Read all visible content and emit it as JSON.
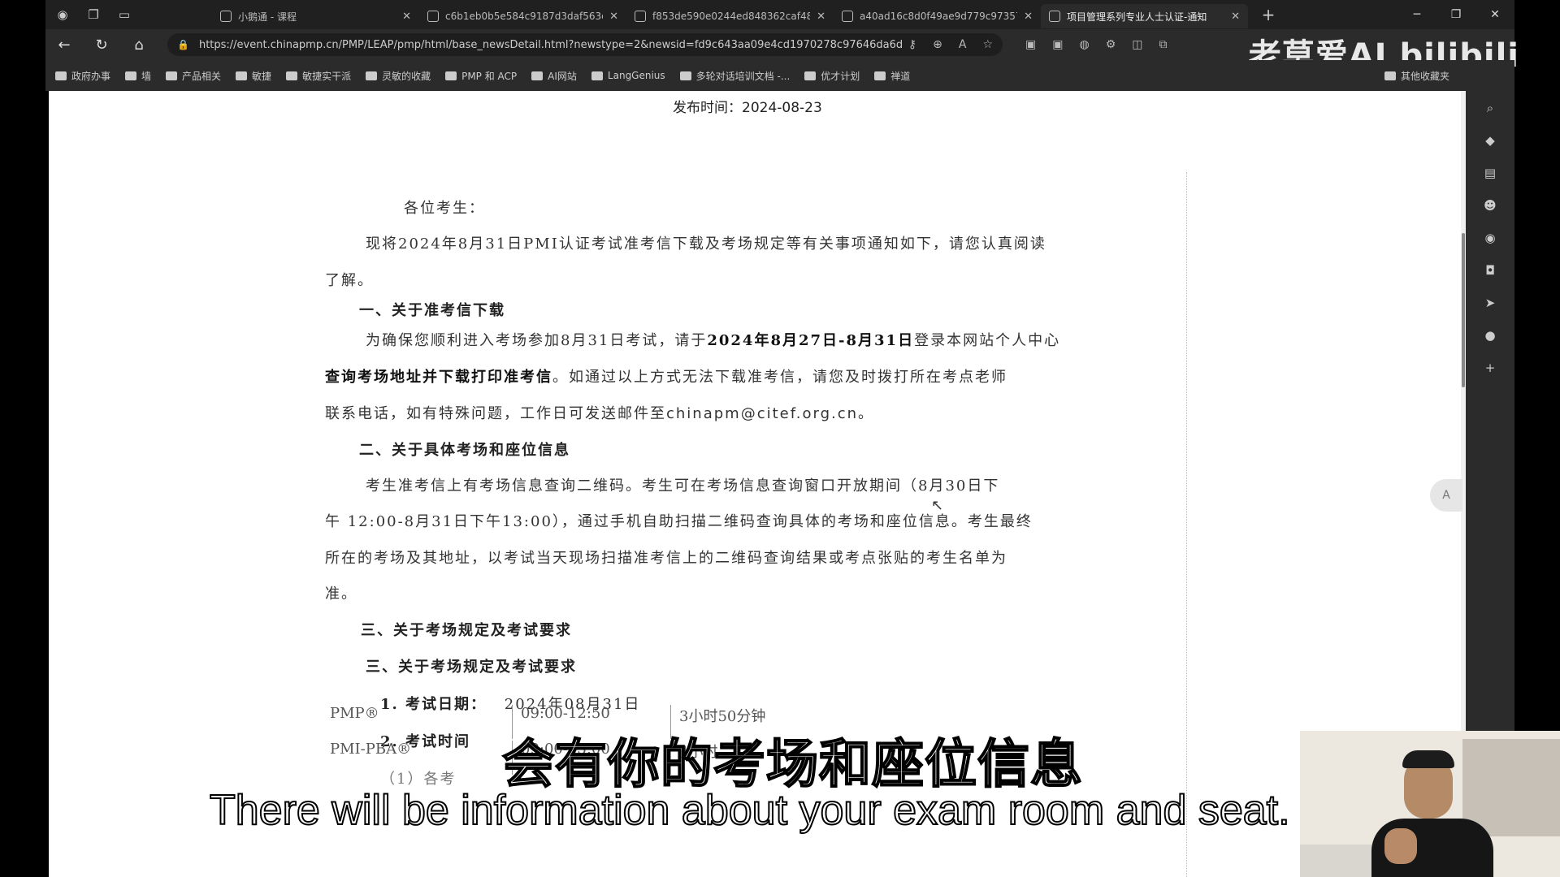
{
  "browser": {
    "tabs": [
      {
        "title": "小鹅通 - 课程",
        "active": false
      },
      {
        "title": "c6b1eb0b5e584c9187d3daf563c",
        "active": false
      },
      {
        "title": "f853de590e0244ed848362caf48c",
        "active": false
      },
      {
        "title": "a40ad16c8d0f49ae9d779c97357",
        "active": false
      },
      {
        "title": "项目管理系列专业人士认证-通知",
        "active": true
      }
    ],
    "new_tab": "+",
    "url": "https://event.chinapmp.cn/PMP/LEAP/pmp/html/base_newsDetail.html?newstype=2&newsid=fd9c643aa09e4cd1970278c97646da6d",
    "bookmarks": [
      "政府办事",
      "墙",
      "产品相关",
      "敏捷",
      "敏捷实干派",
      "灵敏的收藏",
      "PMP 和 ACP",
      "AI网站",
      "LangGenius",
      "多轮对话培训文档 -...",
      "优才计划",
      "禅道"
    ],
    "bookmarks_right": "其他收藏夹",
    "watermark": "老莫爱AI bilibili"
  },
  "article": {
    "publish_time": "发布时间：2024-08-23",
    "greeting": "各位考生：",
    "intro_1": "现将2024年8月31日PMI认证考试准考信下载及考场规定等有关事项通知如下，请您认真阅读",
    "intro_2": "了解。",
    "section1_title": "一、关于准考信下载",
    "s1_p1_a": "为确保您顺利进入考场参加8月31日考试，请于",
    "s1_p1_b": "2024年8月27日-8月31日",
    "s1_p1_c": "登录本网站个人中心",
    "s1_p2_a": "查询考场地址并下载打印准考信",
    "s1_p2_b": "。如通过以上方式无法下载准考信，请您及时拨打所在考点老师",
    "s1_p3_a": "联系电话，如有特殊问题，工作日可发送邮件至",
    "s1_p3_email": "chinapm@citef.org.cn",
    "s1_p3_b": "。",
    "section2_title": "二、关于具体考场和座位信息",
    "s2_p1": "考生准考信上有考场信息查询二维码。考生可在考场信息查询窗口开放期间（8月30日下",
    "s2_p2": "午 12:00-8月31日下午13:00），通过手机自助扫描二维码查询具体的考场和座位信息。考生最终",
    "s2_p3": "所在的考场及其地址，以考试当天现场扫描准考信上的二维码查询结果或考点张贴的考生名单为",
    "s2_p4": "准。",
    "section3_title_a": "三、关于考场规定及考试要求",
    "section3_title_b": "三、关于考场规定及考试要求",
    "item1_label": "1.  考试日期：",
    "item1_value": "2024年08月31日",
    "item2_label": "2.  考试时间",
    "item2_sub": "（1）各考"
  },
  "table": {
    "rows": [
      {
        "name": "PMP®",
        "time": "09:00-12:50",
        "duration": "3小时50分钟"
      },
      {
        "name": "PMI-PBA®",
        "time": "09:00-13:00",
        "duration": "4小时"
      }
    ]
  },
  "subtitles": {
    "cn": "会有你的考场和座位信息",
    "en": "There will be information about your exam room and seat."
  }
}
